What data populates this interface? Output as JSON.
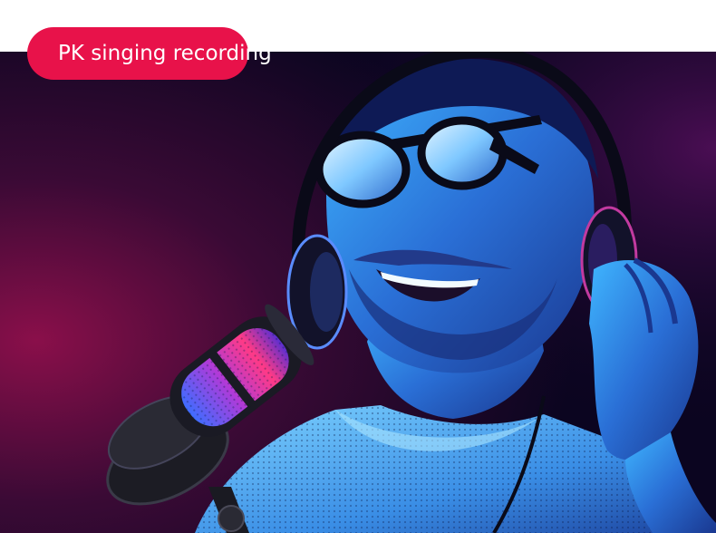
{
  "banner": {
    "label": "PK singing recording"
  },
  "colors": {
    "page_background": "#ffffff",
    "pill_background": "#e8124a",
    "pill_text": "#ffffff",
    "scene_background": "#0b0520",
    "rim_light_magenta": "#b0156a",
    "key_light_cyan": "#2fa8ff"
  },
  "scene": {
    "description_icons": [
      "person-with-headphones",
      "sunglasses-icon",
      "headphones-icon",
      "rgb-microphone-icon",
      "microphone-stand-icon"
    ]
  }
}
